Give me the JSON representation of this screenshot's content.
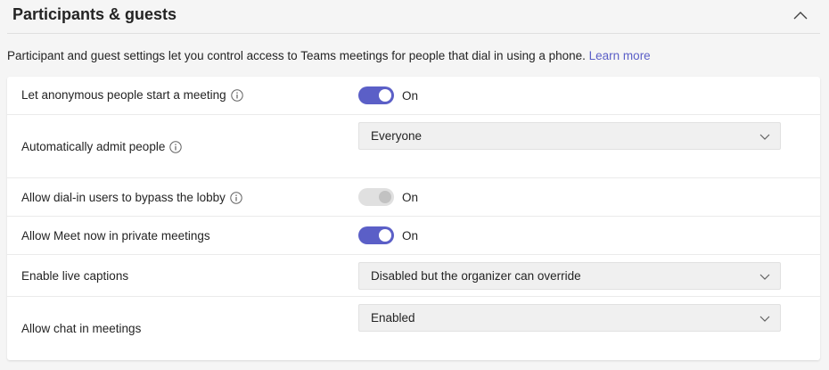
{
  "section": {
    "title": "Participants & guests",
    "description": "Participant and guest settings let you control access to Teams meetings for people that dial in using a phone.",
    "learn_more": "Learn more",
    "collapse_icon": "chevron-up-icon"
  },
  "settings": {
    "anonymous_start": {
      "label": "Let anonymous people start a meeting",
      "state": "On",
      "enabled": true
    },
    "auto_admit": {
      "label": "Automatically admit people",
      "value": "Everyone"
    },
    "dialin_bypass": {
      "label": "Allow dial-in users to bypass the lobby",
      "state": "On",
      "enabled": false
    },
    "meet_now": {
      "label": "Allow Meet now in private meetings",
      "state": "On",
      "enabled": true
    },
    "live_captions": {
      "label": "Enable live captions",
      "value": "Disabled but the organizer can override"
    },
    "chat": {
      "label": "Allow chat in meetings",
      "value": "Enabled"
    }
  },
  "colors": {
    "accent": "#5b5fc7",
    "toggle_disabled": "#e0e0e0",
    "dropdown_bg": "#f0f0f0",
    "page_bg": "#f5f5f5"
  }
}
